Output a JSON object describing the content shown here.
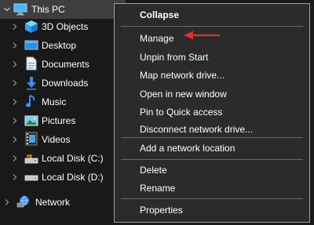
{
  "tree": {
    "this_pc": "This PC",
    "items": [
      {
        "label": "3D Objects",
        "icon": "3d-objects-icon"
      },
      {
        "label": "Desktop",
        "icon": "desktop-icon"
      },
      {
        "label": "Documents",
        "icon": "documents-icon"
      },
      {
        "label": "Downloads",
        "icon": "downloads-icon"
      },
      {
        "label": "Music",
        "icon": "music-icon"
      },
      {
        "label": "Pictures",
        "icon": "pictures-icon"
      },
      {
        "label": "Videos",
        "icon": "videos-icon"
      },
      {
        "label": "Local Disk (C:)",
        "icon": "local-disk-icon"
      },
      {
        "label": "Local Disk (D:)",
        "icon": "local-disk-icon"
      }
    ],
    "network": "Network"
  },
  "context_menu": {
    "items": [
      {
        "label": "Collapse"
      },
      {
        "label": "Manage"
      },
      {
        "label": "Unpin from Start"
      },
      {
        "label": "Map network drive..."
      },
      {
        "label": "Open in new window"
      },
      {
        "label": "Pin to Quick access"
      },
      {
        "label": "Disconnect network drive..."
      },
      {
        "label": "Add a network location"
      },
      {
        "label": "Delete"
      },
      {
        "label": "Rename"
      },
      {
        "label": "Properties"
      }
    ]
  },
  "colors": {
    "background": "#191919",
    "menu_background": "#2b2b2b",
    "selected_row": "#3e3e3e",
    "annotation_arrow": "#e03030"
  }
}
